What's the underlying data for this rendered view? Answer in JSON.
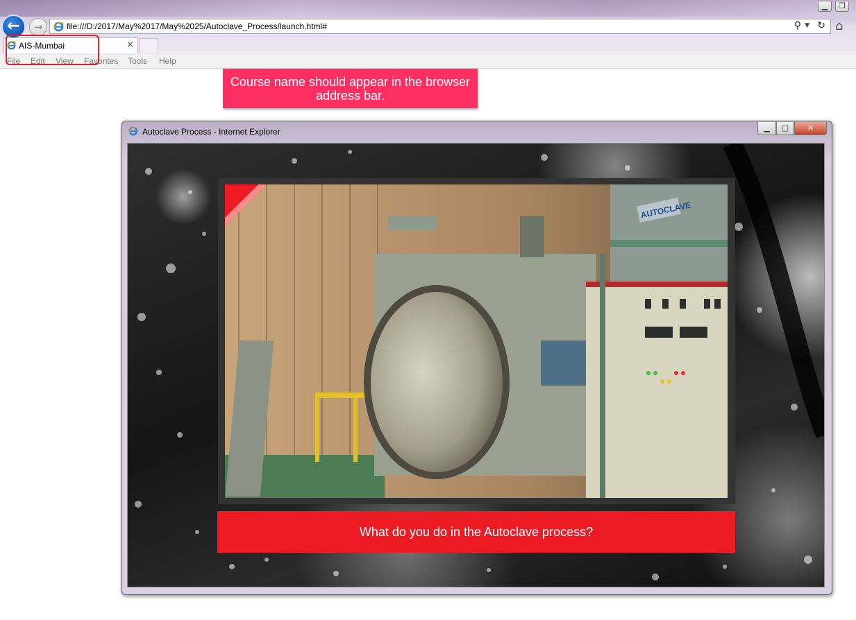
{
  "browser": {
    "address": "file:///D:/2017/May%2017/May%2025/Autoclave_Process/launch.html#",
    "tab_title": "AIS-Mumbai",
    "menu": [
      "File",
      "Edit",
      "View",
      "Favorites",
      "Tools",
      "Help"
    ]
  },
  "callout": {
    "text": "Course name should appear in the browser address bar."
  },
  "inner_window": {
    "title": "Autoclave Process - Internet Explorer",
    "photo_label": "AUTOCLAVE",
    "question": "What do you do in the Autoclave process?"
  },
  "colors": {
    "callout_bg": "#ff2e63",
    "question_bg": "#ed1c24",
    "highlight_border": "#e0202a",
    "ie_blue": "#1456b8"
  },
  "icons": {
    "back": "arrow-left-icon",
    "forward": "arrow-right-icon",
    "search": "search-icon",
    "refresh": "refresh-icon",
    "home": "home-icon",
    "close_tab": "close-icon",
    "page": "ie-logo-icon"
  }
}
